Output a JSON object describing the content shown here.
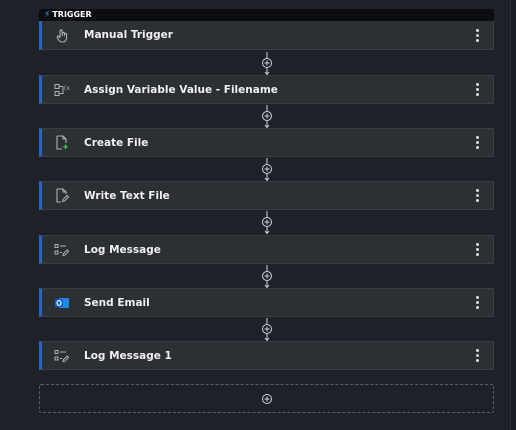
{
  "trigger_badge": {
    "label": "TRIGGER",
    "icon": "bolt-icon"
  },
  "steps": [
    {
      "label": "Manual Trigger",
      "icon": "hand-pointer-icon"
    },
    {
      "label": "Assign Variable Value - Filename",
      "icon": "assign-variable-icon"
    },
    {
      "label": "Create File",
      "icon": "create-file-icon"
    },
    {
      "label": "Write Text File",
      "icon": "write-file-icon"
    },
    {
      "label": "Log Message",
      "icon": "log-message-icon"
    },
    {
      "label": "Send Email",
      "icon": "outlook-icon"
    },
    {
      "label": "Log Message 1",
      "icon": "log-message-icon"
    }
  ],
  "colors": {
    "accent": "#2b67c2",
    "background": "#1e2228",
    "card": "#2c2f34",
    "create_file_green": "#3fbf5a",
    "outlook_blue": "#0a64c8"
  }
}
